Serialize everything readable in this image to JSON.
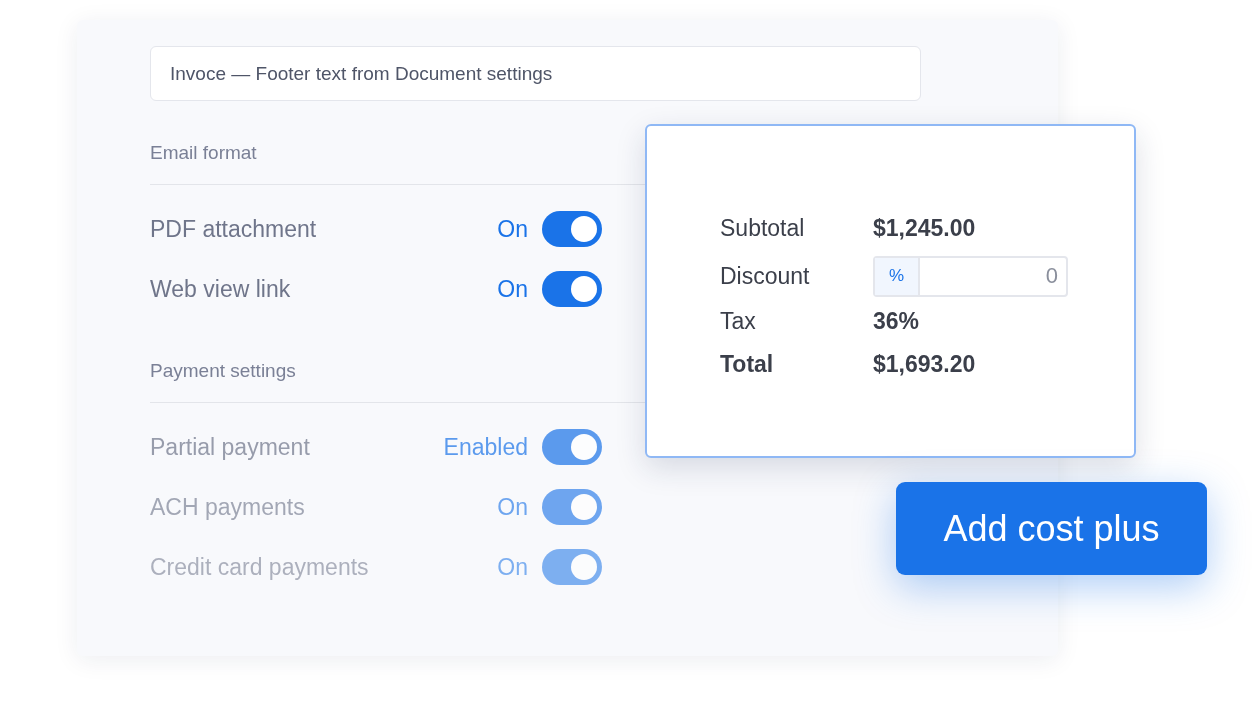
{
  "footer_field": {
    "value": "Invoce — Footer text from Document settings"
  },
  "sections": [
    {
      "title": "Email format",
      "rows": [
        {
          "label": "PDF attachment",
          "status": "On",
          "on": true
        },
        {
          "label": "Web view link",
          "status": "On",
          "on": true
        }
      ]
    },
    {
      "title": "Payment settings",
      "rows": [
        {
          "label": "Partial payment",
          "status": "Enabled",
          "on": true
        },
        {
          "label": "ACH payments",
          "status": "On",
          "on": true
        },
        {
          "label": "Credit card payments",
          "status": "On",
          "on": true
        }
      ]
    }
  ],
  "summary": {
    "rows": [
      {
        "kind": "amount",
        "label": "Subtotal",
        "value": "$1,245.00"
      },
      {
        "kind": "input",
        "label": "Discount",
        "prefix": "%",
        "placeholder": "0"
      },
      {
        "kind": "amount",
        "label": "Tax",
        "value": "36%"
      },
      {
        "kind": "total",
        "label": "Total",
        "value": "$1,693.20"
      }
    ]
  },
  "action_button": {
    "label": "Add cost plus"
  }
}
